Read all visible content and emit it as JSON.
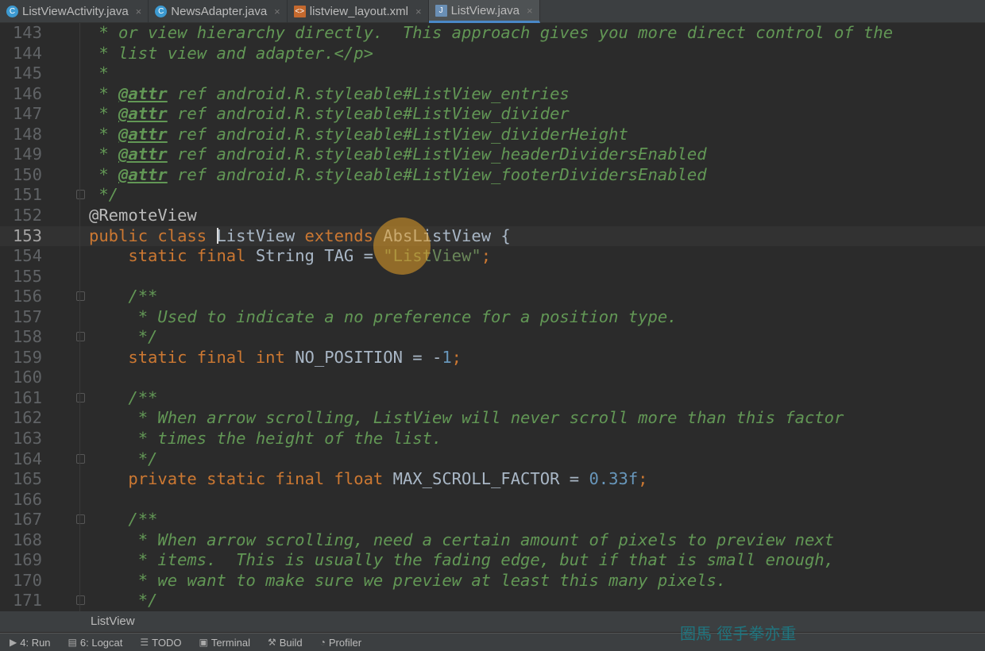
{
  "tabs": [
    {
      "label": "ListViewActivity.java",
      "icon": "class-icon",
      "active": false
    },
    {
      "label": "NewsAdapter.java",
      "icon": "class-icon",
      "active": false
    },
    {
      "label": "listview_layout.xml",
      "icon": "xml-file-icon",
      "active": false
    },
    {
      "label": "ListView.java",
      "icon": "java-file-icon",
      "active": true
    }
  ],
  "colors": {
    "background": "#2b2b2b",
    "keyword": "#cc7832",
    "comment": "#629755",
    "string": "#6a8759",
    "number": "#6897bb",
    "text": "#a9b7c6"
  },
  "current_line": 153,
  "lines": [
    {
      "n": "143",
      "t": [
        [
          "c",
          " * or view hierarchy directly.  This approach gives you more direct control of the"
        ]
      ]
    },
    {
      "n": "144",
      "t": [
        [
          "c",
          " * list view and adapter.</p>"
        ]
      ]
    },
    {
      "n": "145",
      "t": [
        [
          "c",
          " *"
        ]
      ]
    },
    {
      "n": "146",
      "t": [
        [
          "c",
          " * "
        ],
        [
          "t",
          "@attr"
        ],
        [
          "c",
          " ref android.R.styleable#ListView_entries"
        ]
      ]
    },
    {
      "n": "147",
      "t": [
        [
          "c",
          " * "
        ],
        [
          "t",
          "@attr"
        ],
        [
          "c",
          " ref android.R.styleable#ListView_divider"
        ]
      ]
    },
    {
      "n": "148",
      "t": [
        [
          "c",
          " * "
        ],
        [
          "t",
          "@attr"
        ],
        [
          "c",
          " ref android.R.styleable#ListView_dividerHeight"
        ]
      ]
    },
    {
      "n": "149",
      "t": [
        [
          "c",
          " * "
        ],
        [
          "t",
          "@attr"
        ],
        [
          "c",
          " ref android.R.styleable#ListView_headerDividersEnabled"
        ]
      ]
    },
    {
      "n": "150",
      "t": [
        [
          "c",
          " * "
        ],
        [
          "t",
          "@attr"
        ],
        [
          "c",
          " ref android.R.styleable#ListView_footerDividersEnabled"
        ]
      ]
    },
    {
      "n": "151",
      "t": [
        [
          "c",
          " */"
        ]
      ],
      "fold": true
    },
    {
      "n": "152",
      "t": [
        [
          "a",
          "@RemoteView"
        ]
      ]
    },
    {
      "n": "153",
      "t": [
        [
          "k",
          "public class "
        ],
        [
          "p",
          "ListView "
        ],
        [
          "k",
          "extends "
        ],
        [
          "p",
          "AbsListView {"
        ]
      ]
    },
    {
      "n": "154",
      "t": [
        [
          "k",
          "    static final "
        ],
        [
          "p",
          "String TAG = "
        ],
        [
          "s",
          "\"ListView\""
        ],
        [
          "k",
          ";"
        ]
      ]
    },
    {
      "n": "155",
      "t": []
    },
    {
      "n": "156",
      "t": [
        [
          "c",
          "    /**"
        ]
      ],
      "fold": true
    },
    {
      "n": "157",
      "t": [
        [
          "c",
          "     * Used to indicate a no preference for a position type."
        ]
      ]
    },
    {
      "n": "158",
      "t": [
        [
          "c",
          "     */"
        ]
      ],
      "fold": true
    },
    {
      "n": "159",
      "t": [
        [
          "k",
          "    static final int "
        ],
        [
          "p",
          "NO_POSITION = -"
        ],
        [
          "n",
          "1"
        ],
        [
          "k",
          ";"
        ]
      ]
    },
    {
      "n": "160",
      "t": []
    },
    {
      "n": "161",
      "t": [
        [
          "c",
          "    /**"
        ]
      ],
      "fold": true
    },
    {
      "n": "162",
      "t": [
        [
          "c",
          "     * When arrow scrolling, ListView will never scroll more than this factor"
        ]
      ]
    },
    {
      "n": "163",
      "t": [
        [
          "c",
          "     * times the height of the list."
        ]
      ]
    },
    {
      "n": "164",
      "t": [
        [
          "c",
          "     */"
        ]
      ],
      "fold": true
    },
    {
      "n": "165",
      "t": [
        [
          "k",
          "    private static final float "
        ],
        [
          "p",
          "MAX_SCROLL_FACTOR = "
        ],
        [
          "n",
          "0.33f"
        ],
        [
          "k",
          ";"
        ]
      ]
    },
    {
      "n": "166",
      "t": []
    },
    {
      "n": "167",
      "t": [
        [
          "c",
          "    /**"
        ]
      ],
      "fold": true
    },
    {
      "n": "168",
      "t": [
        [
          "c",
          "     * When arrow scrolling, need a certain amount of pixels to preview next"
        ]
      ]
    },
    {
      "n": "169",
      "t": [
        [
          "c",
          "     * items.  This is usually the fading edge, but if that is small enough,"
        ]
      ]
    },
    {
      "n": "170",
      "t": [
        [
          "c",
          "     * we want to make sure we preview at least this many pixels."
        ]
      ]
    },
    {
      "n": "171",
      "t": [
        [
          "c",
          "     */"
        ]
      ],
      "fold": true
    }
  ],
  "breadcrumb": "ListView",
  "toolwindows": [
    {
      "label": "4: Run",
      "icon": "run-icon"
    },
    {
      "label": "6: Logcat",
      "icon": "logcat-icon"
    },
    {
      "label": "TODO",
      "icon": "todo-icon"
    },
    {
      "label": "Terminal",
      "icon": "terminal-icon"
    },
    {
      "label": "Build",
      "icon": "build-icon"
    },
    {
      "label": "Profiler",
      "icon": "profiler-icon"
    }
  ],
  "watermark": "圈馬 徑手拳亦重"
}
